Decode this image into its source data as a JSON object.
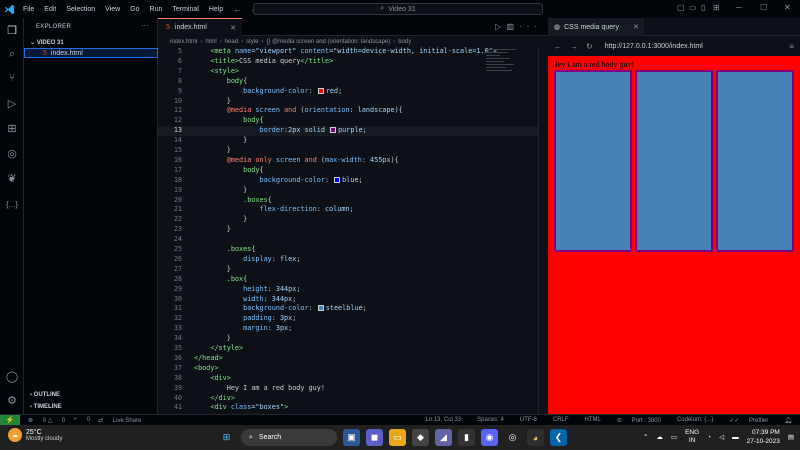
{
  "titlebar": {
    "menu": [
      "File",
      "Edit",
      "Selection",
      "View",
      "Go",
      "Run",
      "Terminal",
      "Help"
    ],
    "search": "Video 31"
  },
  "explorer": {
    "header": "EXPLORER",
    "folder": "VIDEO 31",
    "file": "index.html",
    "outline": "OUTLINE",
    "timeline": "TIMELINE"
  },
  "editor": {
    "tab_label": "index.html",
    "breadcrumb": [
      "index.html",
      "html",
      "head",
      "style",
      "{} @media screen and (orientation: landscape)",
      "body"
    ],
    "active_line": 13
  },
  "browser": {
    "tab_title": "CSS media query",
    "url": "http://127.0.0.1:3000/index.html",
    "page_text": "Hey I am a red body guy!",
    "box_color": "#4682b4",
    "bg_color": "#ff0000"
  },
  "status": {
    "errors": "0",
    "warnings": "0",
    "ports": "0",
    "live_share": "Live Share",
    "position": "Ln 13, Col 33",
    "spaces": "Spaces: 4",
    "encoding": "UTF-8",
    "eol": "CRLF",
    "language": "HTML",
    "port": "Port : 3000",
    "codeium": "Codeium: {...}",
    "prettier": "Prettier"
  },
  "taskbar": {
    "temp": "25°C",
    "weather": "Mostly cloudy",
    "search": "Search",
    "lang1": "ENG",
    "lang2": "IN",
    "time": "07:39 PM",
    "date": "27-10-2023"
  }
}
